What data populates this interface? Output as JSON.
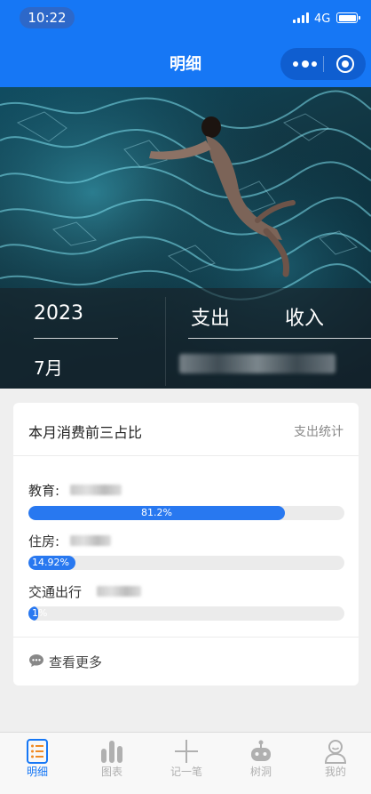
{
  "status_bar": {
    "time": "10:22",
    "network": "4G"
  },
  "nav": {
    "title": "明细"
  },
  "hero": {
    "year": "2023",
    "month": "7月",
    "expense_label": "支出",
    "income_label": "收入"
  },
  "card": {
    "title": "本月消费前三占比",
    "link": "支出统计",
    "categories": [
      {
        "label": "教育:",
        "percent": 81.2,
        "percent_text": "81.2%"
      },
      {
        "label": "住房:",
        "percent": 14.92,
        "percent_text": "14.92%"
      },
      {
        "label": "交通出行",
        "percent": 1,
        "percent_text": "1%"
      }
    ],
    "more_label": "查看更多"
  },
  "tabbar": {
    "items": [
      {
        "label": "明细",
        "icon": "list-icon",
        "active": true
      },
      {
        "label": "图表",
        "icon": "bar-chart-icon",
        "active": false
      },
      {
        "label": "记一笔",
        "icon": "plus-icon",
        "active": false
      },
      {
        "label": "树洞",
        "icon": "robot-icon",
        "active": false
      },
      {
        "label": "我的",
        "icon": "user-icon",
        "active": false
      }
    ]
  },
  "colors": {
    "primary": "#1677f5",
    "bar_fill": "#2878f0",
    "tab_active": "#1677f5",
    "tab_inactive": "#b0b0b0"
  }
}
